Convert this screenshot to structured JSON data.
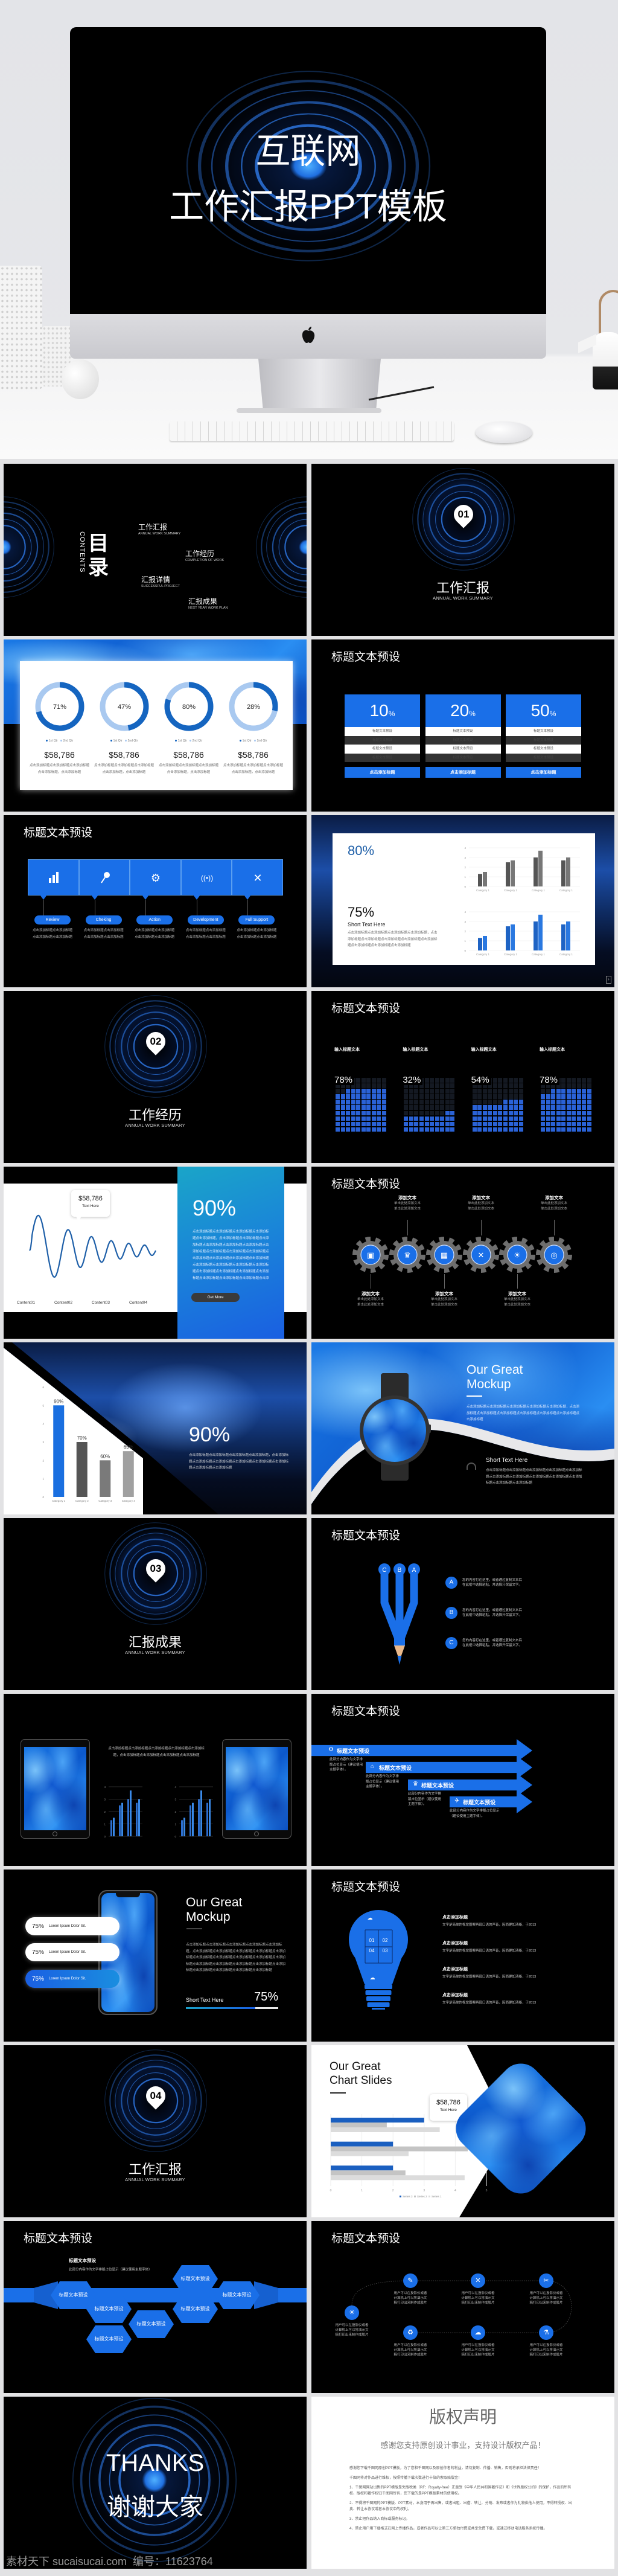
{
  "hero": {
    "title_line1": "互联网",
    "title_line2": "工作汇报PPT模板"
  },
  "slides": {
    "contents": {
      "title": "目录",
      "subtitle": "CONTENTS",
      "items": [
        {
          "zh": "工作汇报",
          "en": "ANNUAL WORK SUMMARY"
        },
        {
          "zh": "工作经历",
          "en": "COMPLETION OF WORK"
        },
        {
          "zh": "汇报详情",
          "en": "SUCCESSFUL PROJECT"
        },
        {
          "zh": "汇报成果",
          "en": "NEXT YEAR WORK PLAN"
        }
      ]
    },
    "section1": {
      "number": "01",
      "title": "工作汇报",
      "subtitle": "ANNUAL WORK SUMMARY"
    },
    "donuts": {
      "colors": {
        "primary": "#1565c0",
        "secondary": "#a9c9f0"
      },
      "items": [
        {
          "percent": 71,
          "label": "71%",
          "legend": [
            "1st Qtr",
            "2nd Qtr"
          ],
          "value": "$58,786",
          "desc": "点击添加标题点击添加标题点击添加标题点击添加标题，点击添加标题"
        },
        {
          "percent": 47,
          "label": "47%",
          "legend": [
            "1st Qtr",
            "2nd Qtr"
          ],
          "value": "$58,786",
          "desc": "点击添加标题点击添加标题点击添加标题点击添加标题，点击添加标题"
        },
        {
          "percent": 80,
          "label": "80%",
          "legend": [
            "1st Qtr",
            "2nd Qtr"
          ],
          "value": "$58,786",
          "desc": "点击添加标题点击添加标题点击添加标题点击添加标题，点击添加标题"
        },
        {
          "percent": 28,
          "label": "28%",
          "legend": [
            "1st Qtr",
            "2nd Qtr"
          ],
          "value": "$58,786",
          "desc": "点击添加标题点击添加标题点击添加标题点击添加标题，点击添加标题"
        }
      ]
    },
    "pricing": {
      "title": "标题文本预设",
      "columns": [
        {
          "value": "10",
          "unit": "%",
          "rows": [
            "标题文本预设",
            "标题文本预设",
            "标题文本预设",
            "标题文本预设"
          ],
          "button": "点击添加标题"
        },
        {
          "value": "20",
          "unit": "%",
          "rows": [
            "标题文本预设",
            "标题文本预设",
            "标题文本预设",
            "标题文本预设"
          ],
          "button": "点击添加标题"
        },
        {
          "value": "50",
          "unit": "%",
          "rows": [
            "标题文本预设",
            "标题文本预设",
            "标题文本预设",
            "标题文本预设"
          ],
          "button": "点击添加标题"
        }
      ]
    },
    "steps": {
      "title": "标题文本预设",
      "items": [
        {
          "label": "Review",
          "icon": "bar-chart-icon",
          "desc": "点击添加标题点击添加标题点击添加标题点击添加标题"
        },
        {
          "label": "Cheking",
          "icon": "pin-icon",
          "desc": "点击添加标题点击添加标题点击添加标题点击添加标题"
        },
        {
          "label": "Action",
          "icon": "gears-icon",
          "desc": "点击添加标题点击添加标题点击添加标题点击添加标题"
        },
        {
          "label": "Development",
          "icon": "signal-icon",
          "desc": "点击添加标题点击添加标题点击添加标题点击添加标题"
        },
        {
          "label": "Full Support",
          "icon": "tools-icon",
          "desc": "点击添加标题点击添加标题点击添加标题点击添加标题"
        }
      ]
    },
    "bridge": {
      "big1": "80%",
      "big2": "75%",
      "short": "Short Text Here",
      "desc": "点击添加标题点击添加标题点击添加标题点击添加标题，点击添加标题点击添加标题点击添加标题点击添加标题点击添加标题点击添加标题点击添加标题点击添加标题"
    },
    "section2": {
      "number": "02",
      "title": "工作经历",
      "subtitle": "ANNUAL WORK SUMMARY"
    },
    "grids": {
      "title": "标题文本预设",
      "colors": {
        "filled": "#2a62d6",
        "empty": "#141922"
      },
      "items": [
        {
          "label": "输入标题文本",
          "value": 78,
          "display": "78%"
        },
        {
          "label": "输入标题文本",
          "value": 32,
          "display": "32%"
        },
        {
          "label": "输入标题文本",
          "value": 54,
          "display": "54%"
        },
        {
          "label": "输入标题文本",
          "value": 78,
          "display": "78%"
        }
      ]
    },
    "wave": {
      "callout_value": "$58,786",
      "callout_text": "Text Here",
      "labels": [
        "Content01",
        "Content02",
        "Content03",
        "Content04"
      ],
      "big": "90%",
      "desc": "点击添加标题点击添加标题点击添加标题点击添加标题点击添加标题，点击添加标题点击添加标题点击添加标题点击添加标题点击添加标题点击添加标题点击添加标题点击添加标题点击添加标题点击添加标题点击添加标题点击添加标题点击添加标题点击添加标题点击添加标题点击添加标题点击添加标题点击添加标题点击添加标题点击添加标题点击添加标题点击添加标题点击添加标题点击添加标题点击添加标题点击添加标题点击添加标题点击添加标题点击添加标题点击添加标题点击添加标题",
      "button": "Get More"
    },
    "gears": {
      "title": "标题文本预设",
      "items": [
        {
          "icon": "briefcase-icon",
          "glyph": "▣",
          "label": "添加文本",
          "sub": [
            "单击此处添加文本",
            "单击此处添加文本"
          ]
        },
        {
          "icon": "trophy-icon",
          "glyph": "♛",
          "label": "添加文本",
          "sub": [
            "单击此处添加文本",
            "单击此处添加文本"
          ]
        },
        {
          "icon": "calendar-icon",
          "glyph": "▦",
          "label": "添加文本",
          "sub": [
            "单击此处添加文本",
            "单击此处添加文本"
          ]
        },
        {
          "icon": "tools-icon",
          "glyph": "✕",
          "label": "添加文本",
          "sub": [
            "单击此处添加文本",
            "单击此处添加文本"
          ]
        },
        {
          "icon": "lightbulb-icon",
          "glyph": "☀",
          "label": "添加文本",
          "sub": [
            "单击此处添加文本",
            "单击此处添加文本"
          ]
        },
        {
          "icon": "search-icon",
          "glyph": "◎",
          "label": "添加文本",
          "sub": [
            "单击此处添加文本",
            "单击此处添加文本"
          ]
        }
      ]
    },
    "diagonal": {
      "big": "90%",
      "desc": "点击添加标题点击添加标题点击添加标题点击添加标题，点击添加标题点击添加标题点击添加标题点击添加标题点击添加标题点击添加标题点击添加标题点击添加标题"
    },
    "watch": {
      "title1": "Our Great",
      "title2": "Mockup",
      "desc": "点击添加标题点击添加标题点击添加标题点击添加标题点击添加标题，点击添加标题点击添加标题点击添加标题点击添加标题点击添加标题点击添加标题点击添加标题",
      "short": "Short Text Here",
      "desc2": "点击添加标题点击添加标题点击添加标题点击添加标题点击添加标题点击添加标题点击添加标题点击添加标题点击添加标题点击添加标题点击添加标题点击添加标题"
    },
    "section3": {
      "number": "03",
      "title": "汇报成果",
      "subtitle": "ANNUAL WORK SUMMARY"
    },
    "pencil": {
      "title": "标题文本预设",
      "heads": [
        "C",
        "B",
        "A"
      ],
      "items": [
        {
          "letter": "A",
          "line1": "您的内容打在这里，或者通过复制文本后",
          "line2": "在此框中选择粘贴，并选择只保留文字。"
        },
        {
          "letter": "B",
          "line1": "您的内容打在这里，或者通过复制文本后",
          "line2": "在此框中选择粘贴，并选择只保留文字。"
        },
        {
          "letter": "C",
          "line1": "您的内容打在这里，或者通过复制文本后",
          "line2": "在此框中选择粘贴，并选择只保留文字。"
        }
      ]
    },
    "tablets": {
      "desc": "点击添加标题点击添加标题点击添加标题点击添加标题点击添加标题，点击添加标题点击添加标题点击添加标题点击添加标题"
    },
    "arrows": {
      "title": "标题文本预设",
      "items": [
        {
          "icon": "gear-icon",
          "glyph": "⚙",
          "label": "标题文本预设",
          "desc": "此部分内容作为文字排版占位显示（建议使用主题字体）。"
        },
        {
          "icon": "home-icon",
          "glyph": "⌂",
          "label": "标题文本预设",
          "desc": "此部分内容作为文字排版占位显示（建议使用主题字体）。"
        },
        {
          "icon": "trophy-icon",
          "glyph": "♛",
          "label": "标题文本预设",
          "desc": "此部分内容作为文字排版占位显示（建议使用主题字体）。"
        },
        {
          "icon": "paper-plane-icon",
          "glyph": "✈",
          "label": "标题文本预设",
          "desc": "此部分内容作为文字排版占位显示（建议使用主题字体）。"
        }
      ]
    },
    "phone": {
      "pills": [
        {
          "value": "75%",
          "label": "Lorem Ipsum Dolor Sit."
        },
        {
          "value": "75%",
          "label": "Lorem Ipsum Dolor Sit."
        },
        {
          "value": "75%",
          "label": "Lorem Ipsum Dolor Sit."
        }
      ],
      "title1": "Our Great",
      "title2": "Mockup",
      "desc": "点击添加标题点击添加标题点击添加标题点击添加标题点击添加标题，点击添加标题点击添加标题点击添加标题点击添加标题点击添加标题点击添加标题点击添加标题点击添加标题点击添加标题点击添加标题点击添加标题点击添加标题点击添加标题点击添加标题点击添加标题点击添加标题点击添加标题点击添加标题点击添加标题",
      "short": "Short Text Here",
      "progress_label": "75%",
      "progress": 75
    },
    "bulb": {
      "title": "标题文本预设",
      "pieces": [
        "01",
        "02",
        "04",
        "03"
      ],
      "items": [
        {
          "title": "点击添加标题",
          "text": "文字是简单的视觉图案再现口语的声音，因而更加清晰，于2013"
        },
        {
          "title": "点击添加标题",
          "text": "文字是简单的视觉图案再现口语的声音，因而更加清晰，于2013"
        },
        {
          "title": "点击添加标题",
          "text": "文字是简单的视觉图案再现口语的声音，因而更加清晰，于2013"
        },
        {
          "title": "点击添加标题",
          "text": "文字是简单的视觉图案再现口语的声音，因而更加清晰，于2013"
        }
      ]
    },
    "section4": {
      "number": "04",
      "title": "工作汇报",
      "subtitle": "ANNUAL WORK SUMMARY"
    },
    "chartslide": {
      "title1": "Our Great",
      "title2": "Chart Slides",
      "callout_value": "$58,786",
      "callout_text": "Text Here"
    },
    "hex": {
      "title": "标题文本预设",
      "subhead": "标题文本预设",
      "subtext": "此部分内容作为文字排版占位显示（建议使用主题字体）",
      "labels": [
        "标题文本预设",
        "标题文本预设",
        "标题文本预设",
        "标题文本预设",
        "标题文本预设",
        "标题文本预设",
        "标题文本预设"
      ]
    },
    "timeline": {
      "title": "标题文本预设",
      "items": [
        {
          "icon": "lightbulb-icon",
          "glyph": "☀",
          "lines": [
            "用户可以在投影仪或者",
            "计算机上可以将演示文",
            "稿打印出来制作成胶片"
          ]
        },
        {
          "icon": "pencil-icon",
          "glyph": "✎",
          "lines": [
            "用户可以在投影仪或者",
            "计算机上可以将演示文",
            "稿打印出来制作成胶片"
          ]
        },
        {
          "icon": "tools-icon",
          "glyph": "✕",
          "lines": [
            "用户可以在投影仪或者",
            "计算机上可以将演示文",
            "稿打印出来制作成胶片"
          ]
        },
        {
          "icon": "scissors-icon",
          "glyph": "✂",
          "lines": [
            "用户可以在投影仪或者",
            "计算机上可以将演示文",
            "稿打印出来制作成胶片"
          ]
        },
        {
          "icon": "recycle-icon",
          "glyph": "♻",
          "lines": [
            "用户可以在投影仪或者",
            "计算机上可以将演示文",
            "稿打印出来制作成胶片"
          ]
        },
        {
          "icon": "cloud-upload-icon",
          "glyph": "☁",
          "lines": [
            "用户可以在投影仪或者",
            "计算机上可以将演示文",
            "稿打印出来制作成胶片"
          ]
        },
        {
          "icon": "flask-icon",
          "glyph": "⚗",
          "lines": [
            "用户可以在投影仪或者",
            "计算机上可以将演示文",
            "稿打印出来制作成胶片"
          ]
        }
      ]
    },
    "thanks": {
      "title": "THANKS",
      "subtitle": "谢谢大家",
      "watermark": "素材天下 sucaisucai.com  编号：11623764"
    },
    "copyright": {
      "title": "版权声明",
      "subtitle": "感谢您支持原创设计事业，支持设计版权产品！",
      "paragraphs": [
        "感谢您下载千图网原创PPT模板，为了您和千图网以及原创作者的利益，请勿复制、传播、销售，否则将承担法律责任！",
        "千图网将对作品进行维权，按照传播下载次数进行十倍的索取赔偿金！",
        "1、千图网网站出售的PPT模版是免版税类（RF：Royalty-free）正版受《中华人民共和国著作法》和《世界版权公约》的保护，作品的所有权、版权和著作权归千图网所有，您下载的是PPT模版素材的使用权。",
        "2、不得将千图网的PPT模版、PPT素材，本身用于再出售，或者出租、出借、转让、分销、发布或者作为礼物供他人使用，不得转授权、出卖、转让本协议或者本协议中的权利。",
        "3、禁止把作品纳入商标或服务标记。",
        "4、禁止用户用下载格式在网上传播作品，或者作品可以让第三方单独付费或共享免费下载，或通过移动电话服务系统传播。"
      ]
    }
  },
  "chart_data": [
    {
      "id": "bridge-top",
      "type": "bar",
      "categories": [
        "Category 1",
        "Category 1",
        "Category 1",
        "Category 1"
      ],
      "series": [
        {
          "values": [
            1.3,
            2.5,
            3.0,
            2.7
          ]
        },
        {
          "values": [
            1.5,
            2.7,
            3.7,
            3.0
          ]
        }
      ],
      "ylim": [
        0,
        4
      ],
      "yticks": [
        "0",
        "1",
        "2",
        "3",
        "4"
      ],
      "colors": [
        "#555555",
        "#777777"
      ],
      "grid": true
    },
    {
      "id": "bridge-bottom",
      "type": "bar",
      "categories": [
        "Category 1",
        "Category 1",
        "Category 1",
        "Category 1"
      ],
      "series": [
        {
          "values": [
            1.3,
            2.5,
            3.0,
            2.7
          ]
        },
        {
          "values": [
            1.5,
            2.7,
            3.7,
            3.0
          ]
        }
      ],
      "ylim": [
        0,
        4
      ],
      "yticks": [
        "0",
        "1",
        "2",
        "3",
        "4"
      ],
      "colors": [
        "#1e63c4",
        "#2a78e0"
      ],
      "grid": true
    },
    {
      "id": "diagonal-bars",
      "type": "bar",
      "categories": [
        "Category 1",
        "Category 2",
        "Category 3",
        "Category 4"
      ],
      "values": [
        5,
        3,
        2,
        2.5
      ],
      "labels": [
        "90%",
        "70%",
        "60%",
        "65%"
      ],
      "ylim": [
        0,
        6
      ],
      "yticks": [
        "0",
        "1",
        "2",
        "3",
        "4",
        "5",
        "6"
      ],
      "colors": [
        "#1a6fe0",
        "#555555",
        "#7a7a7a",
        "#a0a0a0"
      ]
    },
    {
      "id": "tablet-left",
      "type": "bar",
      "categories": [
        "",
        "",
        "",
        ""
      ],
      "series": [
        {
          "values": [
            1.3,
            2.5,
            3.0,
            2.7
          ]
        },
        {
          "values": [
            1.5,
            2.7,
            3.7,
            3.0
          ]
        }
      ],
      "ylim": [
        0,
        4
      ],
      "yticks": [
        "0",
        "1",
        "2",
        "3",
        "4"
      ],
      "colors": [
        "#2d6fd0",
        "#3a8ae8"
      ],
      "grid": true
    },
    {
      "id": "tablet-right",
      "type": "bar",
      "categories": [
        "",
        "",
        "",
        ""
      ],
      "series": [
        {
          "values": [
            1.3,
            2.5,
            3.0,
            2.7
          ]
        },
        {
          "values": [
            1.5,
            2.7,
            3.7,
            3.0
          ]
        }
      ],
      "ylim": [
        0,
        4
      ],
      "yticks": [
        "0",
        "1",
        "2",
        "3",
        "4"
      ],
      "colors": [
        "#2d6fd0",
        "#3a8ae8"
      ],
      "grid": true
    },
    {
      "id": "chart-slides",
      "type": "bar",
      "orientation": "horizontal",
      "categories": [
        "",
        "",
        ""
      ],
      "series": [
        {
          "name": "Series 3",
          "values": [
            3,
            2,
            2
          ]
        },
        {
          "name": "Series 2",
          "values": [
            1.8,
            4.4,
            2.4
          ]
        },
        {
          "name": "Series 1",
          "values": [
            3.5,
            2.5,
            4.3
          ]
        }
      ],
      "xlim": [
        0,
        5
      ],
      "xticks": [
        "0",
        "1",
        "2",
        "3",
        "4",
        "5"
      ],
      "colors": [
        "#1a5fc0",
        "#c4c4c4",
        "#dcdcdc"
      ],
      "legend": "bottom"
    }
  ]
}
